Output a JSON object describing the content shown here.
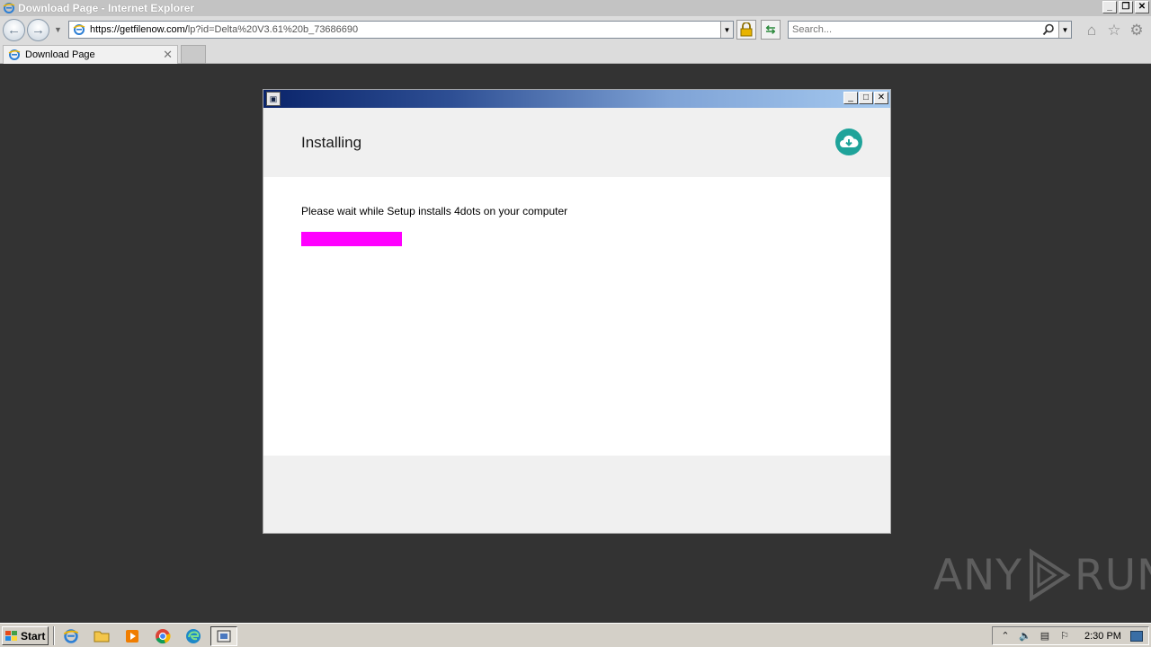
{
  "browser": {
    "window_title": "Download Page - Internet Explorer",
    "address": {
      "host": "https://getfilenow.com/",
      "path": "lp?id=Delta%20V3.61%20b_73686690"
    },
    "search_placeholder": "Search...",
    "tab": {
      "label": "Download Page",
      "close_glyph": "✕"
    }
  },
  "setup_dialog": {
    "heading": "Installing",
    "message": "Please wait while Setup installs 4dots on your computer",
    "progress_fraction": 0.36,
    "progress_color": "#ff00ff",
    "accent_color": "#1fa39a"
  },
  "watermark": {
    "left": "ANY",
    "right": "RUN"
  },
  "taskbar": {
    "start_label": "Start",
    "apps": [
      "internet-explorer",
      "file-explorer",
      "media-player",
      "chrome",
      "edge",
      "setup-installer"
    ],
    "clock": "2:30 PM"
  }
}
